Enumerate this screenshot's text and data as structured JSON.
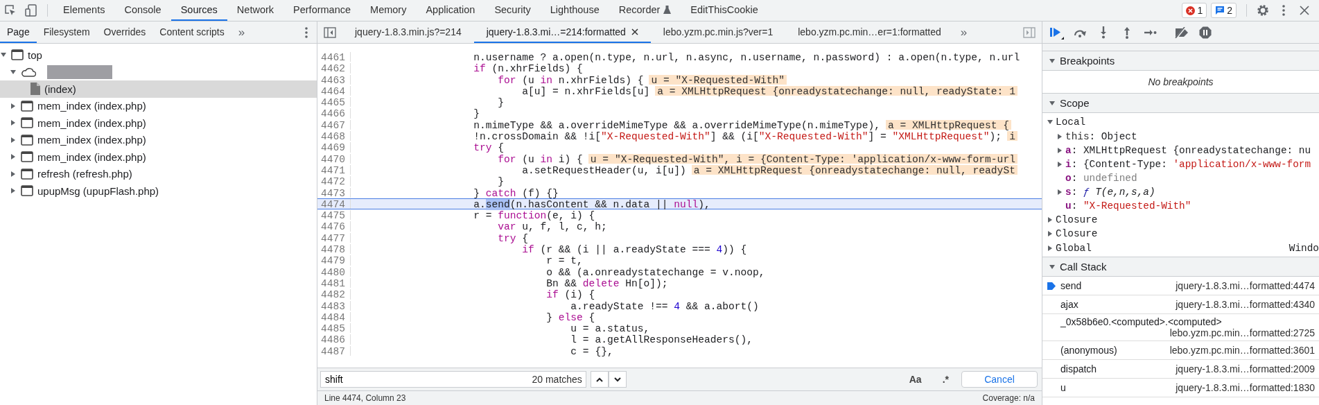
{
  "main_toolbar": {
    "tabs": [
      {
        "label": "Elements",
        "selected": false,
        "experimental": false
      },
      {
        "label": "Console",
        "selected": false,
        "experimental": false
      },
      {
        "label": "Sources",
        "selected": true,
        "experimental": false
      },
      {
        "label": "Network",
        "selected": false,
        "experimental": false
      },
      {
        "label": "Performance",
        "selected": false,
        "experimental": false
      },
      {
        "label": "Memory",
        "selected": false,
        "experimental": false
      },
      {
        "label": "Application",
        "selected": false,
        "experimental": false
      },
      {
        "label": "Security",
        "selected": false,
        "experimental": false
      },
      {
        "label": "Lighthouse",
        "selected": false,
        "experimental": false
      },
      {
        "label": "Recorder",
        "selected": false,
        "experimental": true
      },
      {
        "label": "EditThisCookie",
        "selected": false,
        "experimental": false
      }
    ],
    "error_count": "1",
    "message_count": "2"
  },
  "navigator": {
    "tabs": [
      {
        "label": "Page",
        "selected": true
      },
      {
        "label": "Filesystem",
        "selected": false
      },
      {
        "label": "Overrides",
        "selected": false
      },
      {
        "label": "Content scripts",
        "selected": false
      }
    ],
    "more": "»",
    "tree": [
      {
        "label": "top",
        "kind": "frame",
        "expanded": true,
        "selected": false,
        "children": [
          {
            "kind": "domain",
            "expanded": true,
            "selected": false,
            "redacted": true,
            "children": [
              {
                "label": "(index)",
                "kind": "file",
                "selected": true
              }
            ]
          },
          {
            "label": "mem_index (index.php)",
            "kind": "frame",
            "expanded": false,
            "selected": false
          },
          {
            "label": "mem_index (index.php)",
            "kind": "frame",
            "expanded": false,
            "selected": false
          },
          {
            "label": "mem_index (index.php)",
            "kind": "frame",
            "expanded": false,
            "selected": false
          },
          {
            "label": "mem_index (index.php)",
            "kind": "frame",
            "expanded": false,
            "selected": false
          },
          {
            "label": "refresh (refresh.php)",
            "kind": "frame",
            "expanded": false,
            "selected": false
          },
          {
            "label": "upupMsg (upupFlash.php)",
            "kind": "frame",
            "expanded": false,
            "selected": false
          }
        ]
      }
    ]
  },
  "editor": {
    "tabs": [
      {
        "label": "jquery-1.8.3.min.js?=214",
        "selected": false
      },
      {
        "label": "jquery-1.8.3.mi…=214:formatted",
        "selected": true
      },
      {
        "label": "lebo.yzm.pc.min.js?ver=1",
        "selected": false
      },
      {
        "label": "lebo.yzm.pc.min…er=1:formatted",
        "selected": false
      }
    ],
    "more": "»",
    "lines": [
      {
        "number": "4461",
        "current": false,
        "tokens": [
          "n.username ? a.open(n.type, n.url, n.async, n.username, n.password) : a.open(n.type, n.url"
        ]
      },
      {
        "number": "4462",
        "current": false,
        "tokens": [
          {
            "kind": "keyword",
            "text": "if"
          },
          " (n.xhrFields) {"
        ],
        "children": [
          {
            "number": "4463",
            "current": false,
            "tokens": [
              {
                "kind": "keyword",
                "text": "for"
              },
              " (u ",
              {
                "kind": "keyword",
                "text": "in"
              },
              " n.xhrFields) {"
            ],
            "inline_value": "u = \"X-Requested-With\"",
            "children": [
              {
                "number": "4464",
                "current": false,
                "tokens": [
                  "a[u] = n.xhrFields[u]"
                ],
                "inline_value": "a = XMLHttpRequest {onreadystatechange: null, readyState: 1"
              }
            ]
          },
          {
            "number": "4465",
            "current": false,
            "tokens": [
              "}"
            ]
          }
        ]
      },
      {
        "number": "4466",
        "current": false,
        "tokens": [
          "}"
        ]
      },
      {
        "number": "4467",
        "current": false,
        "tokens": [
          "n.mimeType && a.overrideMimeType && a.overrideMimeType(n.mimeType),"
        ],
        "inline_value": "a = XMLHttpRequest {"
      },
      {
        "number": "4468",
        "current": false,
        "tokens": [
          "!n.crossDomain && !i[",
          {
            "kind": "string",
            "text": "\"X-Requested-With\""
          },
          "] && (i[",
          {
            "kind": "string",
            "text": "\"X-Requested-With\""
          },
          "] = ",
          {
            "kind": "string",
            "text": "\"XMLHttpRequest\""
          },
          ");"
        ],
        "inline_value": "i"
      },
      {
        "number": "4469",
        "current": false,
        "tokens": [
          {
            "kind": "keyword",
            "text": "try"
          },
          " {"
        ],
        "children": [
          {
            "number": "4470",
            "current": false,
            "tokens": [
              {
                "kind": "keyword",
                "text": "for"
              },
              " (u ",
              {
                "kind": "keyword",
                "text": "in"
              },
              " i) {"
            ],
            "inline_value": "u = \"X-Requested-With\", i = {Content-Type: 'application/x-www-form-url",
            "children": [
              {
                "number": "4471",
                "current": false,
                "tokens": [
                  "a.setRequestHeader(u, i[u])"
                ],
                "inline_value": "a = XMLHttpRequest {onreadystatechange: null, readySt"
              }
            ]
          },
          {
            "number": "4472",
            "current": false,
            "tokens": [
              "}"
            ]
          }
        ]
      },
      {
        "number": "4473",
        "current": false,
        "tokens": [
          "} ",
          {
            "kind": "keyword",
            "text": "catch"
          },
          " (f) {}"
        ]
      },
      {
        "number": "4474",
        "current": true,
        "tokens": [
          "a.",
          {
            "kind": "selection",
            "text": "send"
          },
          "(n.hasContent && n.data || ",
          {
            "kind": "keyword",
            "text": "null"
          },
          "),"
        ]
      },
      {
        "number": "4475",
        "current": false,
        "tokens": [
          "r = ",
          {
            "kind": "keyword",
            "text": "function"
          },
          "(e, i) {"
        ],
        "children": [
          {
            "number": "4476",
            "current": false,
            "tokens": [
              {
                "kind": "keyword",
                "text": "var"
              },
              " u, f, l, c, h;"
            ]
          },
          {
            "number": "4477",
            "current": false,
            "tokens": [
              {
                "kind": "keyword",
                "text": "try"
              },
              " {"
            ],
            "children": [
              {
                "number": "4478",
                "current": false,
                "tokens": [
                  {
                    "kind": "keyword",
                    "text": "if"
                  },
                  " (r && (i || a.readyState === ",
                  {
                    "kind": "number",
                    "text": "4"
                  },
                  ")) {"
                ],
                "children": [
                  {
                    "number": "4479",
                    "current": false,
                    "tokens": [
                      "r = t,"
                    ]
                  },
                  {
                    "number": "4480",
                    "current": false,
                    "tokens": [
                      "o && (a.onreadystatechange = v.noop,"
                    ]
                  },
                  {
                    "number": "4481",
                    "current": false,
                    "tokens": [
                      "Bn && ",
                      {
                        "kind": "keyword",
                        "text": "delete"
                      },
                      " Hn[o]);"
                    ]
                  },
                  {
                    "number": "4482",
                    "current": false,
                    "tokens": [
                      {
                        "kind": "keyword",
                        "text": "if"
                      },
                      " (i) {"
                    ],
                    "children": [
                      {
                        "number": "4483",
                        "current": false,
                        "tokens": [
                          "a.readyState !== ",
                          {
                            "kind": "number",
                            "text": "4"
                          },
                          " && a.abort()"
                        ]
                      }
                    ]
                  },
                  {
                    "number": "4484",
                    "current": false,
                    "tokens": [
                      "} ",
                      {
                        "kind": "keyword",
                        "text": "else"
                      },
                      " {"
                    ],
                    "children": [
                      {
                        "number": "4485",
                        "current": false,
                        "tokens": [
                          "u = a.status,"
                        ]
                      },
                      {
                        "number": "4486",
                        "current": false,
                        "tokens": [
                          "l = a.getAllResponseHeaders(),"
                        ]
                      },
                      {
                        "number": "4487",
                        "current": false,
                        "tokens": [
                          "c = {},"
                        ]
                      }
                    ]
                  }
                ]
              }
            ]
          }
        ]
      }
    ],
    "search": {
      "value": "shift",
      "matches": "20 matches",
      "case_toggle": "Aa",
      "regex_toggle": ".*",
      "cancel": "Cancel"
    },
    "status_bar": {
      "position": "Line 4474, Column 23",
      "coverage": "Coverage: n/a"
    }
  },
  "debugger": {
    "breakpoints": {
      "title": "Breakpoints",
      "expanded": true,
      "empty_text": "No breakpoints"
    },
    "scope": {
      "title": "Scope",
      "expanded": true,
      "groups": [
        {
          "name": "Local",
          "expanded": true,
          "properties": [
            {
              "name": "this",
              "internal": true,
              "expandable": true,
              "value": [
                {
                  "kind": "plain",
                  "text": ": Object"
                }
              ]
            },
            {
              "name": "a",
              "internal": false,
              "expandable": true,
              "value": [
                {
                  "kind": "plain",
                  "text": ": XMLHttpRequest {onreadystatechange: nu"
                }
              ]
            },
            {
              "name": "i",
              "internal": false,
              "expandable": true,
              "value": [
                {
                  "kind": "plain",
                  "text": ": {Content-Type: "
                },
                {
                  "kind": "string",
                  "text": "'application/x-www-form"
                }
              ]
            },
            {
              "name": "o",
              "internal": false,
              "expandable": false,
              "value": [
                {
                  "kind": "plain",
                  "text": ": "
                },
                {
                  "kind": "undefined",
                  "text": "undefined"
                }
              ]
            },
            {
              "name": "s",
              "internal": false,
              "expandable": true,
              "value": [
                {
                  "kind": "plain",
                  "text": ": "
                },
                {
                  "kind": "function_mark",
                  "text": "ƒ"
                },
                {
                  "kind": "function",
                  "text": " T(e,n,s,a)"
                }
              ]
            },
            {
              "name": "u",
              "internal": false,
              "expandable": false,
              "value": [
                {
                  "kind": "plain",
                  "text": ": "
                },
                {
                  "kind": "string",
                  "text": "\"X-Requested-With\""
                }
              ]
            }
          ]
        },
        {
          "name": "Closure",
          "expanded": false
        },
        {
          "name": "Closure",
          "expanded": false
        },
        {
          "name": "Global",
          "expanded": false,
          "value": "Windo"
        }
      ]
    },
    "call_stack": {
      "title": "Call Stack",
      "expanded": true,
      "frames": [
        {
          "name": "send",
          "location": "jquery-1.8.3.mi…formatted:4474",
          "current": true
        },
        {
          "name": "ajax",
          "location": "jquery-1.8.3.mi…formatted:4340",
          "current": false
        },
        {
          "name": "_0x58b6e0.<computed>.<computed>",
          "location": "lebo.yzm.pc.min…formatted:2725",
          "current": false
        },
        {
          "name": "(anonymous)",
          "location": "lebo.yzm.pc.min…formatted:3601",
          "current": false
        },
        {
          "name": "dispatch",
          "location": "jquery-1.8.3.mi…formatted:2009",
          "current": false
        },
        {
          "name": "u",
          "location": "jquery-1.8.3.mi…formatted:1830",
          "current": false
        }
      ]
    }
  }
}
